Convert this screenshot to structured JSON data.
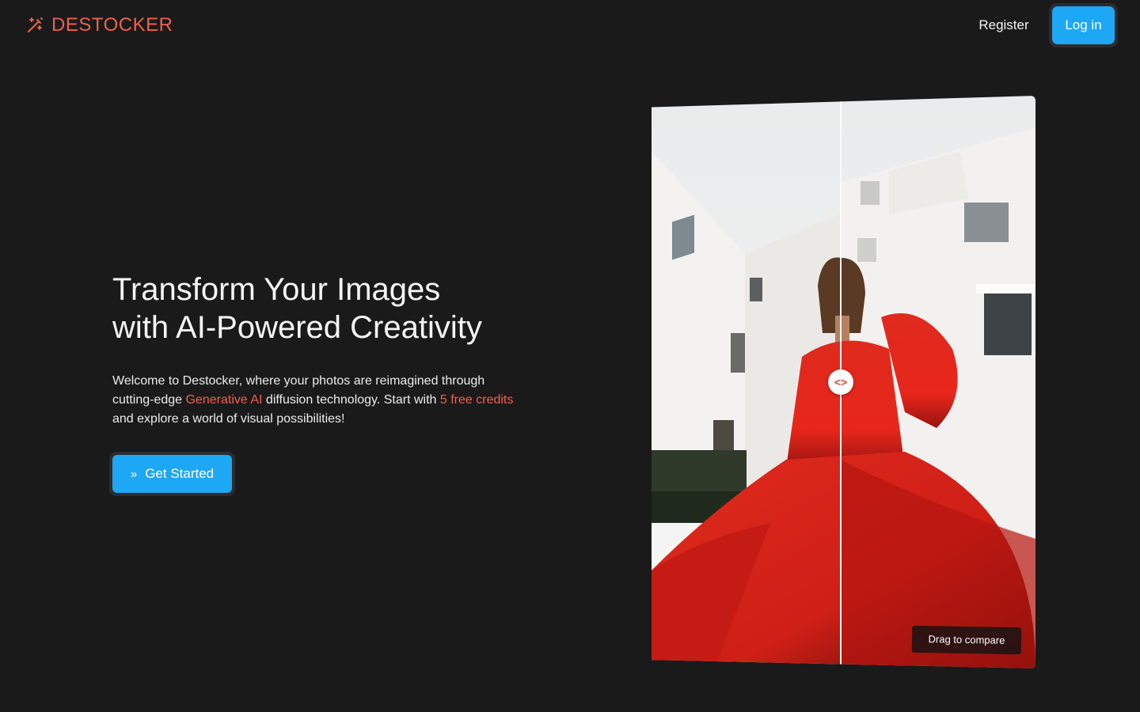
{
  "brand": {
    "name": "DESTOCKER",
    "accent_color": "#f0604a",
    "logo_icon": "magic-wand-icon"
  },
  "nav": {
    "register_label": "Register",
    "login_label": "Log in",
    "button_color": "#1ea7f5"
  },
  "hero": {
    "title_line1": "Transform Your Images",
    "title_line2": "with AI-Powered Creativity",
    "desc_part1": "Welcome to Destocker, where your photos are reimagined through cutting-edge ",
    "desc_highlight1": "Generative AI",
    "desc_part2": " diffusion technology. Start with ",
    "desc_highlight2": "5 free credits",
    "desc_part3": " and explore a world of visual possibilities!",
    "cta_label": "Get Started",
    "cta_icon": "chevrons-right-icon"
  },
  "comparison": {
    "label": "Drag to compare",
    "handle_icon": "code-arrows-icon",
    "dress_color": "#e3261c",
    "building_color": "#f4f3f1"
  }
}
